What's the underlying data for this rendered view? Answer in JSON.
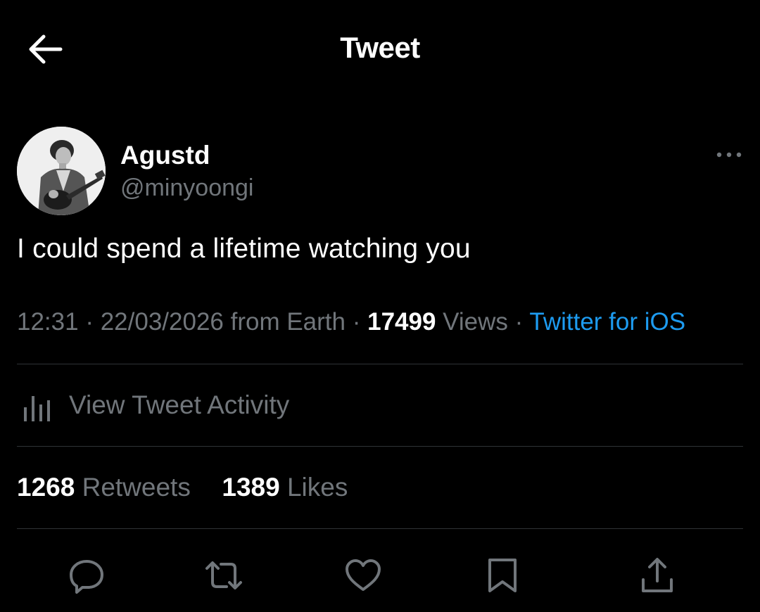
{
  "header": {
    "title": "Tweet",
    "back_icon": "arrow-left-icon"
  },
  "author": {
    "display_name": "Agustd",
    "handle": "@minyoongi"
  },
  "tweet": {
    "text": "I could spend a lifetime watching you",
    "time": "12:31",
    "date": "22/03/2026",
    "location": "from Earth",
    "views_count": "17499",
    "views_label": "Views",
    "source": "Twitter for iOS",
    "separator": " · "
  },
  "activity": {
    "label": "View Tweet Activity",
    "icon": "bar-chart-icon"
  },
  "stats": {
    "retweets_count": "1268",
    "retweets_label": "Retweets",
    "likes_count": "1389",
    "likes_label": "Likes"
  },
  "actions": {
    "reply_icon": "reply-icon",
    "retweet_icon": "retweet-icon",
    "like_icon": "heart-icon",
    "bookmark_icon": "bookmark-icon",
    "share_icon": "share-icon"
  },
  "colors": {
    "background": "#000000",
    "primary_text": "#ffffff",
    "secondary_text": "#71767b",
    "link": "#1d9bf0",
    "divider": "#2f3336"
  }
}
